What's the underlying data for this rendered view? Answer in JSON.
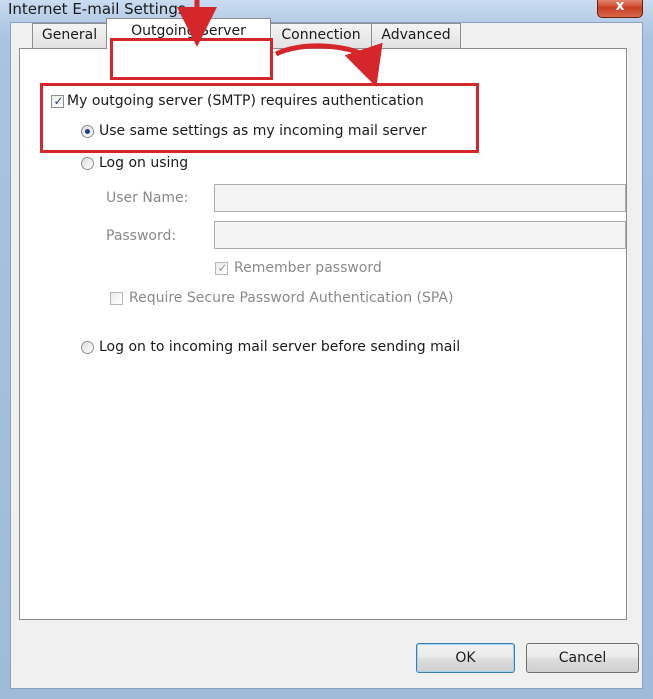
{
  "window": {
    "title": "Internet E-mail Settings",
    "close_label": "x"
  },
  "tabs": [
    {
      "label": "General"
    },
    {
      "label": "Outgoing Server"
    },
    {
      "label": "Connection"
    },
    {
      "label": "Advanced"
    }
  ],
  "active_tab": "Outgoing Server",
  "outgoing": {
    "requires_auth_label": "My outgoing server (SMTP) requires authentication",
    "requires_auth_checked": true,
    "same_settings_label": "Use same settings as my incoming mail server",
    "same_settings_selected": true,
    "log_on_using_label": "Log on using",
    "username_label": "User Name:",
    "username_value": "",
    "password_label": "Password:",
    "password_value": "",
    "remember_password_label": "Remember password",
    "remember_password_checked": true,
    "spa_label": "Require Secure Password Authentication (SPA)",
    "spa_checked": false,
    "log_on_incoming_label": "Log on to incoming mail server before sending mail"
  },
  "buttons": {
    "ok": "OK",
    "cancel": "Cancel"
  },
  "annotation_color": "#d4262b"
}
